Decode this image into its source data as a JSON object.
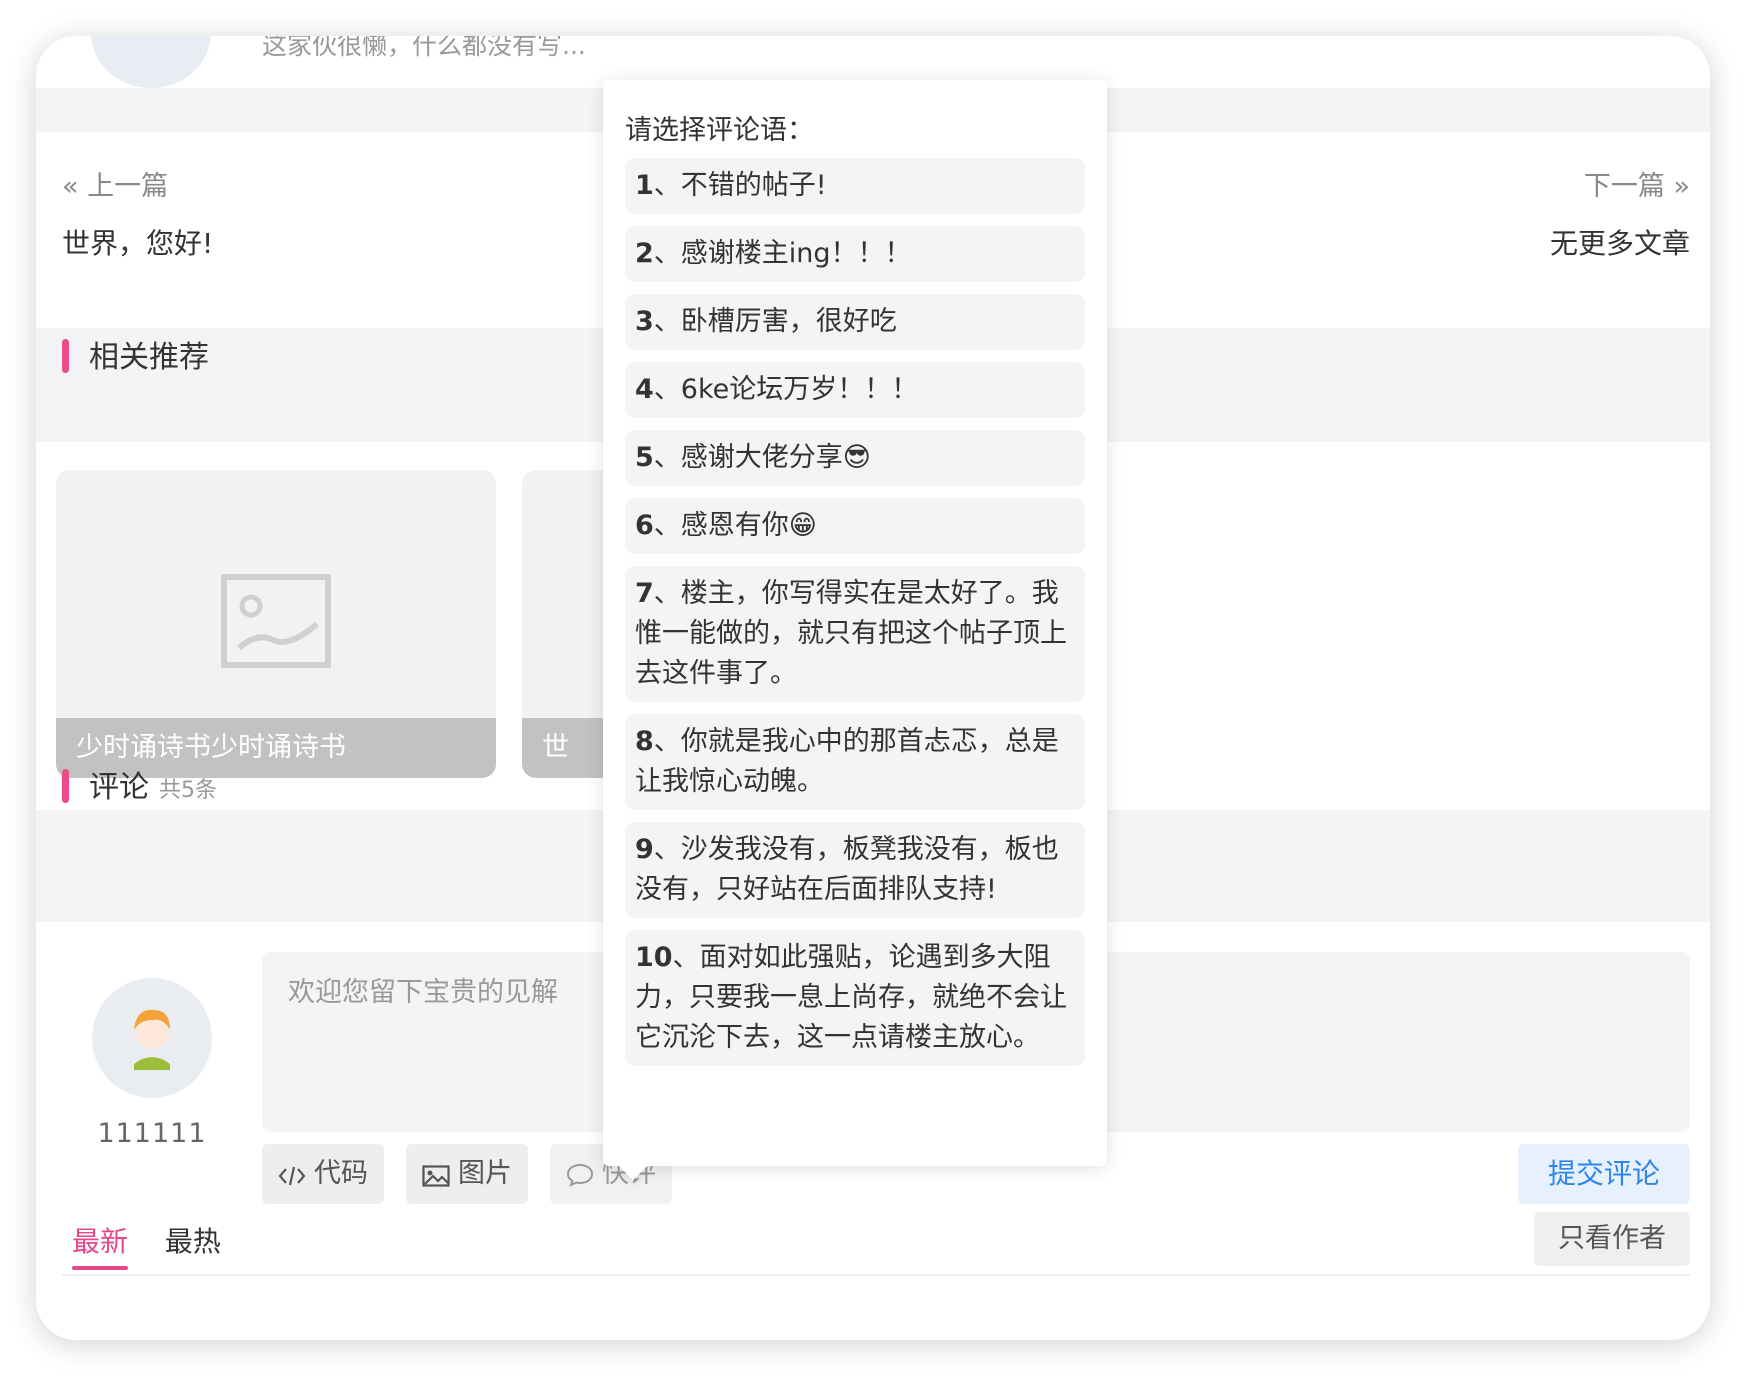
{
  "author": {
    "description": "这家伙很懒，什么都没有写..."
  },
  "post_nav": {
    "prev_label": "上一篇",
    "prev_title": "世界，您好!",
    "next_label": "下一篇",
    "next_title": "无更多文章"
  },
  "related": {
    "heading": "相关推荐",
    "items": [
      {
        "caption": "少时诵诗书少时诵诗书"
      },
      {
        "caption": "世"
      }
    ]
  },
  "comments": {
    "heading": "评论",
    "count": "共5条",
    "user_name": "111111",
    "placeholder": "欢迎您留下宝贵的见解",
    "toolbar": {
      "code_label": "代码",
      "image_label": "图片",
      "quick_label": "快评",
      "submit_label": "提交评论"
    },
    "sort_tabs": [
      "最新",
      "最热"
    ],
    "author_only_label": "只看作者"
  },
  "quick_comment_popover": {
    "title": "请选择评论语：",
    "options": [
      {
        "num": "1",
        "text": "、不错的帖子!"
      },
      {
        "num": "2",
        "text": "、感谢楼主ing！！！"
      },
      {
        "num": "3",
        "text": "、卧槽厉害，很好吃"
      },
      {
        "num": "4",
        "text": "、6ke论坛万岁！！！"
      },
      {
        "num": "5",
        "text": "、感谢大佬分享😎"
      },
      {
        "num": "6",
        "text": "、感恩有你😁"
      },
      {
        "num": "7",
        "text": "、楼主，你写得实在是太好了。我惟一能做的，就只有把这个帖子顶上去这件事了。"
      },
      {
        "num": "8",
        "text": "、你就是我心中的那首忐忑，总是让我惊心动魄。"
      },
      {
        "num": "9",
        "text": "、沙发我没有，板凳我没有，板也没有，只好站在后面排队支持!"
      },
      {
        "num": "10",
        "text": "、面对如此强贴，论遇到多大阻力，只要我一息上尚存，就绝不会让它沉沦下去，这一点请楼主放心。"
      }
    ]
  },
  "colors": {
    "accent_pink": "#ec4a88",
    "link_blue": "#2f86ea",
    "page_bg": "#f3f4f6"
  }
}
